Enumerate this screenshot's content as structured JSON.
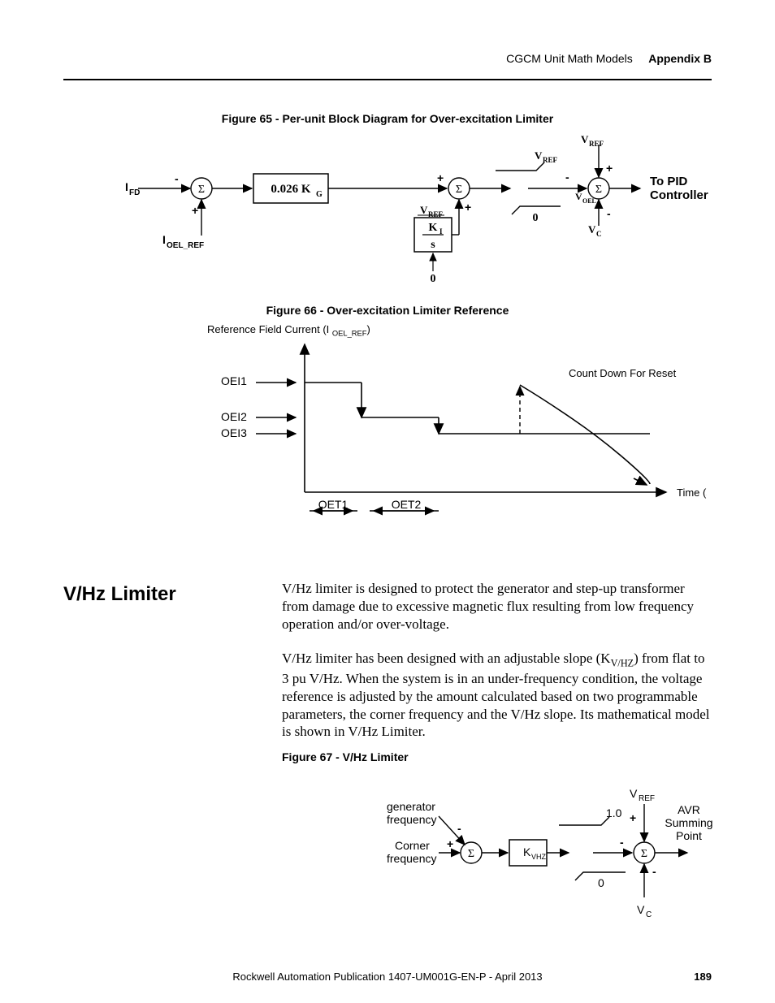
{
  "header": {
    "chapter": "CGCM Unit Math Models",
    "appendix": "Appendix B"
  },
  "fig65": {
    "caption": "Figure 65 - Per-unit Block Diagram for Over-excitation Limiter",
    "labels": {
      "Ifd": "I",
      "Ifd_sub": "FD",
      "Ioel": "I",
      "Ioel_sub": "OEL_REF",
      "gain": "0.026 K",
      "gain_sub": "G",
      "Vref": "V",
      "Vref_sub": "REF",
      "Voel": "V",
      "Voel_sub": "OEL",
      "Vc": "V",
      "Vc_sub": "C",
      "out": "To PID Controller",
      "KI": "K",
      "KI_sub": "I",
      "s": "s",
      "zero": "0",
      "plus": "+",
      "minus": "-",
      "sigma": "Σ"
    }
  },
  "fig66": {
    "caption": "Figure 66 - Over-excitation Limiter Reference",
    "ylabel_pre": "Reference Field Current (I ",
    "ylabel_sub": "OEL_REF",
    "ylabel_post": ")",
    "levels": [
      "OEI1",
      "OEI2",
      "OEI3"
    ],
    "xlabels": [
      "OET1",
      "OET2"
    ],
    "note": "Count Down For Reset",
    "xlabel": "Time (s)"
  },
  "section": {
    "heading": "V/Hz Limiter",
    "para1": "V/Hz limiter is designed to protect the generator and step-up transformer from damage due to excessive magnetic flux resulting from low frequency operation and/or over-voltage.",
    "para2a": "V/Hz limiter has been designed with an adjustable slope (K",
    "para2a_sub": "V/HZ",
    "para2b": ") from flat to 3 pu V/Hz. When the system is in an under-frequency condition, the voltage reference is adjusted by the amount calculated based on two programmable parameters, the corner frequency and the V/Hz slope. Its mathematical model is shown in V/Hz Limiter."
  },
  "fig67": {
    "caption": "Figure 67 - V/Hz Limiter",
    "labels": {
      "genfreq1": "generator",
      "genfreq2": "frequency",
      "cornerfreq1": "Corner",
      "cornerfreq2": "frequency",
      "Kvhz": "K",
      "Kvhz_sub": "VHZ",
      "one": "1.0",
      "zero": "0",
      "Vref": "V",
      "Vref_sub": "REF",
      "Vc": "V",
      "Vc_sub": "C",
      "out1": "AVR",
      "out2": "Summing",
      "out3": "Point",
      "plus": "+",
      "minus": "-",
      "sigma": "Σ"
    }
  },
  "footer": {
    "publication": "Rockwell Automation Publication 1407-UM001G-EN-P - April 2013",
    "page": "189"
  }
}
